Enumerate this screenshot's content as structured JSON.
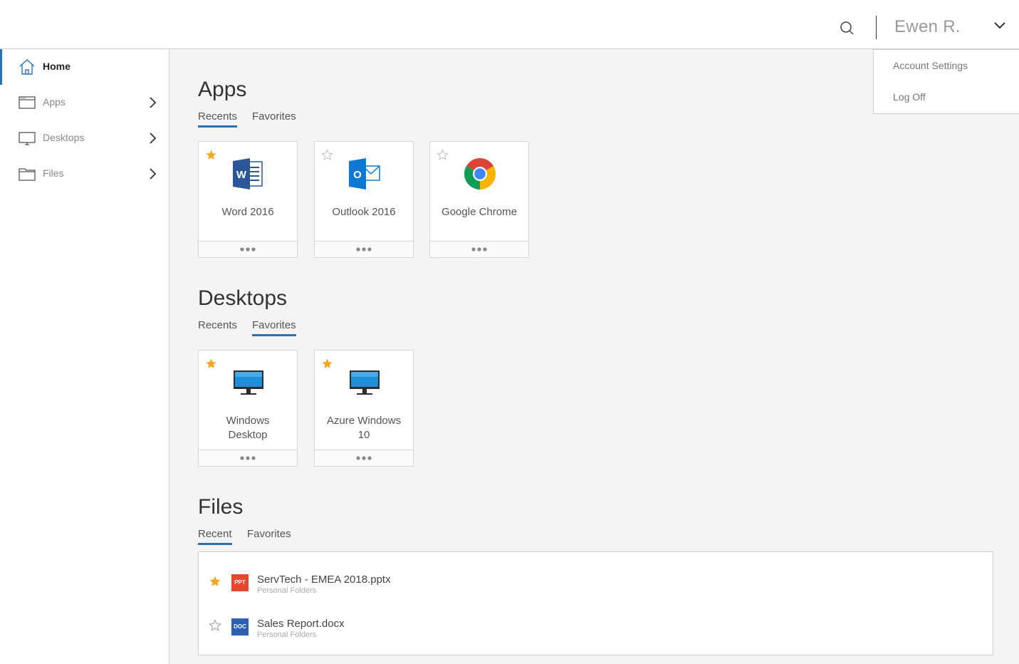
{
  "header": {
    "user_name": "Ewen R.",
    "menu": [
      "Account Settings",
      "Log Off"
    ]
  },
  "sidebar": {
    "items": [
      {
        "label": "Home",
        "icon": "home-icon",
        "active": true
      },
      {
        "label": "Apps",
        "icon": "apps-window-icon"
      },
      {
        "label": "Desktops",
        "icon": "monitor-icon"
      },
      {
        "label": "Files",
        "icon": "folder-icon"
      }
    ]
  },
  "apps": {
    "title": "Apps",
    "tabs": [
      "Recents",
      "Favorites"
    ],
    "active_tab": "Recents",
    "cards": [
      {
        "name": "Word 2016",
        "favorite": true,
        "icon": "word-icon"
      },
      {
        "name": "Outlook 2016",
        "favorite": false,
        "icon": "outlook-icon"
      },
      {
        "name": "Google Chrome",
        "favorite": false,
        "icon": "chrome-icon"
      }
    ]
  },
  "desktops": {
    "title": "Desktops",
    "tabs": [
      "Recents",
      "Favorites"
    ],
    "active_tab": "Favorites",
    "cards": [
      {
        "name_line1": "Windows",
        "name_line2": "Desktop",
        "favorite": true,
        "icon": "desktop-monitor-icon"
      },
      {
        "name_line1": "Azure Windows",
        "name_line2": "10",
        "favorite": true,
        "icon": "desktop-monitor-icon"
      }
    ]
  },
  "files": {
    "title": "Files",
    "tabs": [
      "Recent",
      "Favorites"
    ],
    "active_tab": "Recent",
    "items": [
      {
        "name": "ServTech - EMEA 2018.pptx",
        "location": "Personal Folders",
        "type_badge": "PPT",
        "favorite": true
      },
      {
        "name": "Sales Report.docx",
        "location": "Personal Folders",
        "type_badge": "DOC",
        "favorite": false
      }
    ]
  },
  "colors": {
    "accent": "#2a72b5",
    "star_filled": "#f5a623",
    "ppt": "#e8472b",
    "doc": "#2b5fb4"
  }
}
